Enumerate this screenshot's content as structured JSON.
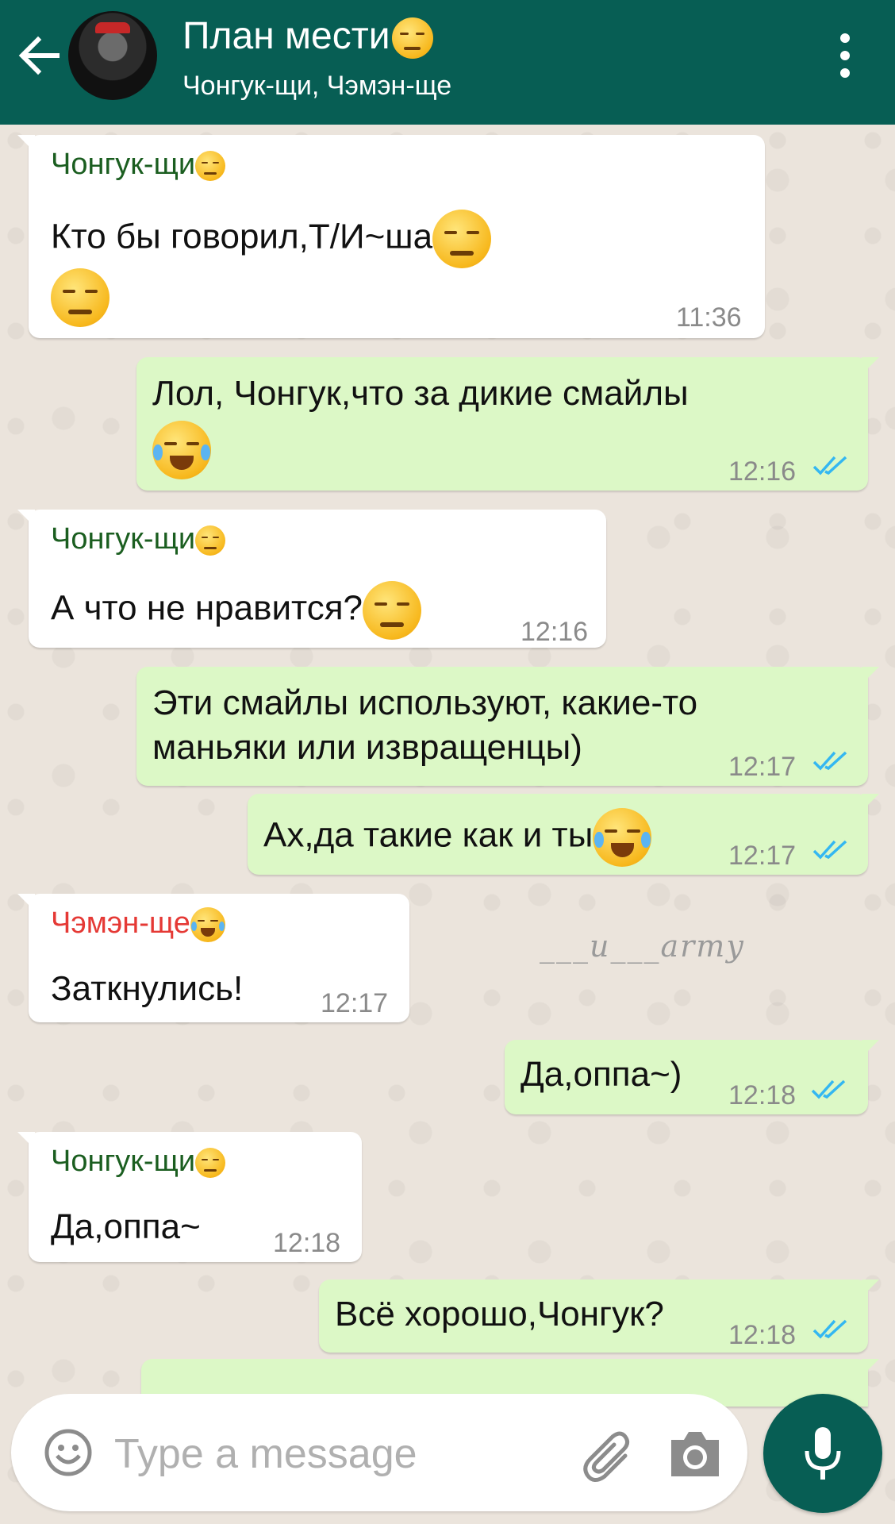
{
  "header": {
    "title": "План мести",
    "subtitle": "Чонгук-щи, Чэмэн-ще",
    "colors": {
      "bar": "#075e54",
      "text": "#ffffff"
    }
  },
  "messages": [
    {
      "direction": "in",
      "sender": "Чонгук-щи",
      "sender_color": "#1b5e20",
      "text": "Кто бы говорил,Т/И~ша",
      "time": "11:36"
    },
    {
      "direction": "out",
      "text_line1": "Лол, Чонгук,что за дикие смайлы",
      "time": "12:16",
      "status": "read"
    },
    {
      "direction": "in",
      "sender": "Чонгук-щи",
      "sender_color": "#1b5e20",
      "text": "А что не нравится?",
      "time": "12:16"
    },
    {
      "direction": "out",
      "text_line1": "Эти смайлы используют, какие-то",
      "text_line2": "маньяки или извращенцы)",
      "time": "12:17",
      "status": "read"
    },
    {
      "direction": "out",
      "text": "Ах,да такие как и ты",
      "time": "12:17",
      "status": "read"
    },
    {
      "direction": "in",
      "sender": "Чэмэн-ще",
      "sender_color": "#e53935",
      "text": "Заткнулись!",
      "time": "12:17"
    },
    {
      "direction": "out",
      "text": "Да,оппа~)",
      "time": "12:18",
      "status": "read"
    },
    {
      "direction": "in",
      "sender": "Чонгук-щи",
      "sender_color": "#1b5e20",
      "text": "Да,оппа~",
      "time": "12:18"
    },
    {
      "direction": "out",
      "text": "Всё хорошо,Чонгук?",
      "time": "12:18",
      "status": "read"
    }
  ],
  "watermark": "___u___army",
  "composer": {
    "placeholder": "Type a message"
  },
  "colors": {
    "incoming_bubble": "#ffffff",
    "outgoing_bubble": "#dcf8c6",
    "read_ticks": "#34b7f1",
    "chat_background": "#ece5dd"
  }
}
